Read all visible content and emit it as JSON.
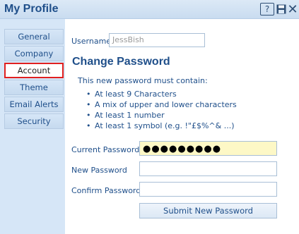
{
  "window": {
    "title": "My Profile"
  },
  "header_icons": {
    "help": "?"
  },
  "sidebar": {
    "items": [
      {
        "label": "General"
      },
      {
        "label": "Company"
      },
      {
        "label": "Account"
      },
      {
        "label": "Theme"
      },
      {
        "label": "Email Alerts"
      },
      {
        "label": "Security"
      }
    ],
    "active_index": 2
  },
  "username": {
    "label": "Username",
    "value": "JessBish"
  },
  "change_password": {
    "title": "Change Password",
    "intro": "This new password must contain:",
    "requirements": [
      "At least 9 Characters",
      "A mix of upper and lower characters",
      "At least 1 number",
      "At least 1 symbol (e.g. !\"£$%^& ...)"
    ]
  },
  "fields": {
    "current": {
      "label": "Current Password",
      "value": "●●●●●●●●●"
    },
    "new": {
      "label": "New Password",
      "value": ""
    },
    "confirm": {
      "label": "Confirm Password",
      "value": ""
    }
  },
  "submit": {
    "label": "Submit New Password"
  },
  "colors": {
    "accent": "#1f4f8a",
    "active_outline": "#e02020",
    "field_highlight": "#fdf8c6"
  }
}
